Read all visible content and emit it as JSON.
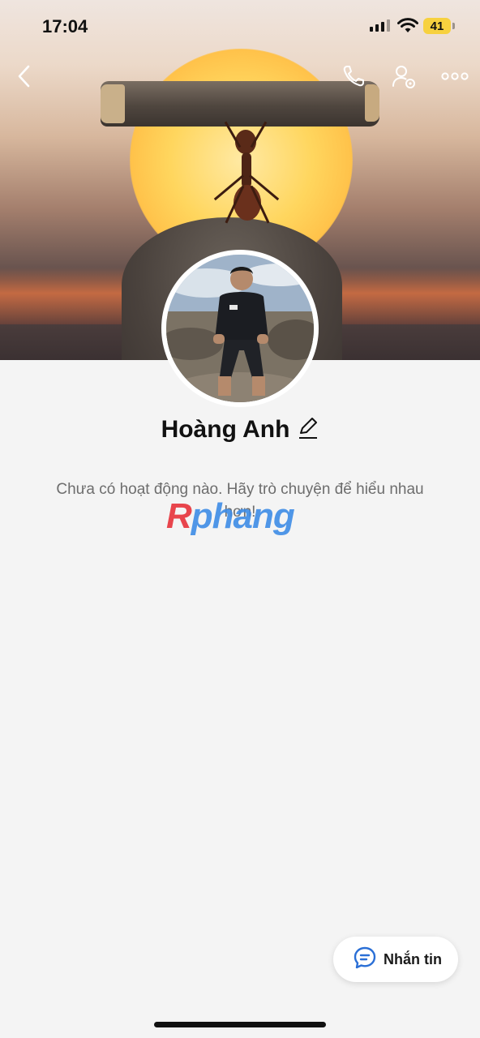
{
  "status_bar": {
    "time": "17:04",
    "battery": "41"
  },
  "profile": {
    "name": "Hoàng Anh",
    "activity_text": "Chưa có hoạt động nào. Hãy trò chuyện để hiểu nhau hơn!"
  },
  "watermark": {
    "part1": "R",
    "part2": "phang"
  },
  "actions": {
    "message_label": "Nhắn tin"
  },
  "icons": {
    "back": "back-chevron-icon",
    "call": "phone-icon",
    "settings": "user-settings-icon",
    "more": "more-dots-icon",
    "edit": "pencil-icon",
    "message": "chat-bubble-icon"
  },
  "colors": {
    "accent_blue": "#2a6fd6",
    "battery_yellow": "#f7d13f",
    "background": "#f4f4f4"
  }
}
